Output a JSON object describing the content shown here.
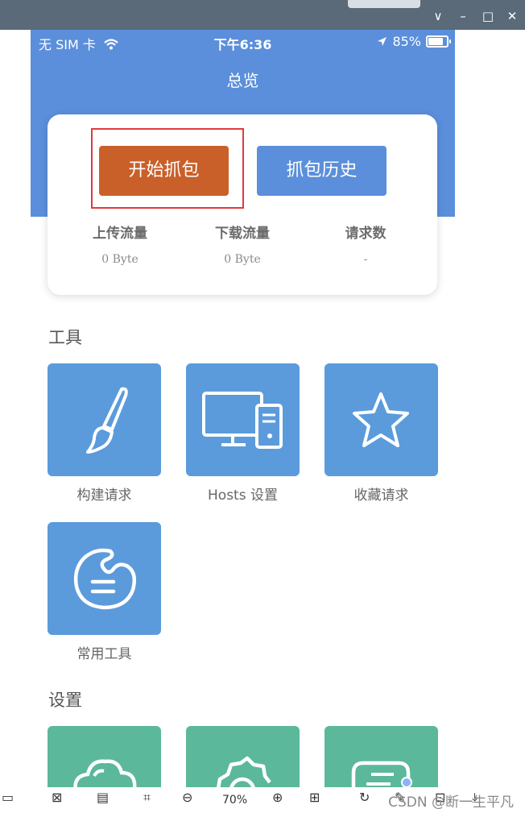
{
  "window": {
    "controls": {
      "chevron": "∨",
      "minimize": "–",
      "maximize": "□",
      "close": "✕"
    }
  },
  "status_bar": {
    "carrier": "无 SIM 卡",
    "time": "下午6:36",
    "battery": "85%"
  },
  "header": {
    "title": "总览"
  },
  "capture_card": {
    "start_label": "开始抓包",
    "history_label": "抓包历史",
    "stats": [
      {
        "label": "上传流量",
        "value": "0 Byte"
      },
      {
        "label": "下载流量",
        "value": "0 Byte"
      },
      {
        "label": "请求数",
        "value": "-"
      }
    ]
  },
  "tools": {
    "title": "工具",
    "items": [
      {
        "label": "构建请求",
        "icon": "paintbrush-icon"
      },
      {
        "label": "Hosts 设置",
        "icon": "computer-icon"
      },
      {
        "label": "收藏请求",
        "icon": "star-icon"
      },
      {
        "label": "常用工具",
        "icon": "palette-icon"
      }
    ]
  },
  "settings": {
    "title": "设置",
    "items": [
      {
        "icon": "cloud-icon"
      },
      {
        "icon": "gear-icon"
      },
      {
        "icon": "message-icon"
      }
    ]
  },
  "bottom_toolbar": {
    "zoom": "70%"
  },
  "watermark": "CSDN @断一生平凡",
  "colors": {
    "primary_blue": "#5b8fdb",
    "start_button": "#c9602a",
    "tile_blue": "#5b9bdc",
    "tile_green": "#5cb89a",
    "highlight": "#e23a3a"
  }
}
